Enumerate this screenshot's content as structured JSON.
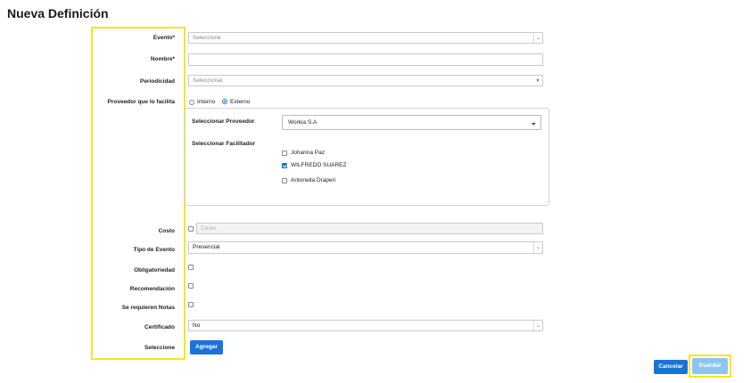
{
  "page": {
    "title": "Nueva Definición"
  },
  "form": {
    "evento": {
      "label": "Evento*",
      "value": "Seleccione"
    },
    "nombre": {
      "label": "Nombre*",
      "value": ""
    },
    "periodicidad": {
      "label": "Periodicidad",
      "value": "Seleccionar"
    },
    "proveedor": {
      "label": "Proveedor que lo facilita",
      "options": {
        "interno": "Interno",
        "externo": "Externo"
      },
      "selected": "Externo"
    },
    "panel": {
      "proveedor_label": "Seleccionar Proveedor",
      "proveedor_value": "Workia S.A",
      "facilitador_label": "Seleccionar Facilitador",
      "facilitadores": [
        {
          "name": "Johanna Paz",
          "checked": false
        },
        {
          "name": "WILFREDO SUAREZ",
          "checked": true
        },
        {
          "name": "Antonella Draperi",
          "checked": false
        }
      ]
    },
    "costo": {
      "label": "Costo",
      "placeholder": "Costo"
    },
    "tipo_evento": {
      "label": "Tipo de Evento",
      "value": "Presencial"
    },
    "obligatoriedad": {
      "label": "Obligatoriedad"
    },
    "recomendacion": {
      "label": "Recomendación"
    },
    "notas": {
      "label": "Se requieren Notas"
    },
    "certificado": {
      "label": "Certificado",
      "value": "No"
    },
    "seleccione": {
      "label": "Seleccione",
      "button": "Agregar"
    }
  },
  "actions": {
    "cancel": "Cancelar",
    "save": "Guardar"
  },
  "colors": {
    "primary": "#1a73d9",
    "save_disabled": "#8ec5ee",
    "highlight": "#f5e71f"
  }
}
